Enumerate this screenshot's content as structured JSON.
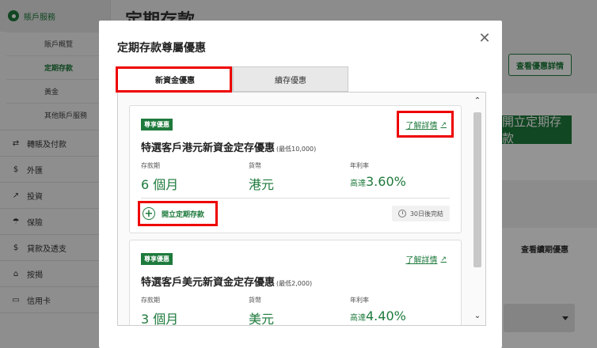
{
  "background": {
    "page_title": "定期存款",
    "view_offer_details_button": "查看優惠詳情",
    "open_deposit_button": "開立定期存款",
    "view_renewal_offers_link": "查看續期優惠"
  },
  "sidebar": {
    "account_services": "賬戶服務",
    "sub_items": [
      "賬戶概覽",
      "定期存款",
      "黃金",
      "其他賬戶服務"
    ],
    "items": [
      "轉賬及付款",
      "外匯",
      "投資",
      "保險",
      "貸款及透支",
      "按揭",
      "信用卡"
    ]
  },
  "modal": {
    "title": "定期存款尊屬優惠",
    "tabs": [
      "新資金優惠",
      "續存優惠"
    ],
    "col_labels": {
      "period": "存款期",
      "currency": "貨幣",
      "rate": "年利率"
    },
    "offers": [
      {
        "badge": "尊享優惠",
        "learn_more": "了解詳情",
        "title": "特選客戶港元新資金定存優惠",
        "min": "(最低10,000)",
        "period": "6 個月",
        "currency": "港元",
        "rate_prefix": "高達",
        "rate": "3.60%",
        "open_label": "開立定期存款",
        "expires": "30日後完結"
      },
      {
        "badge": "尊享優惠",
        "learn_more": "了解詳情",
        "title": "特選客戶美元新資金定存優惠",
        "min": "(最低2,000)",
        "period": "3 個月",
        "currency": "美元",
        "rate_prefix": "高達",
        "rate": "4.40%"
      }
    ]
  },
  "colors": {
    "brand_green": "#1e7a3c",
    "highlight_red": "#e00000"
  }
}
